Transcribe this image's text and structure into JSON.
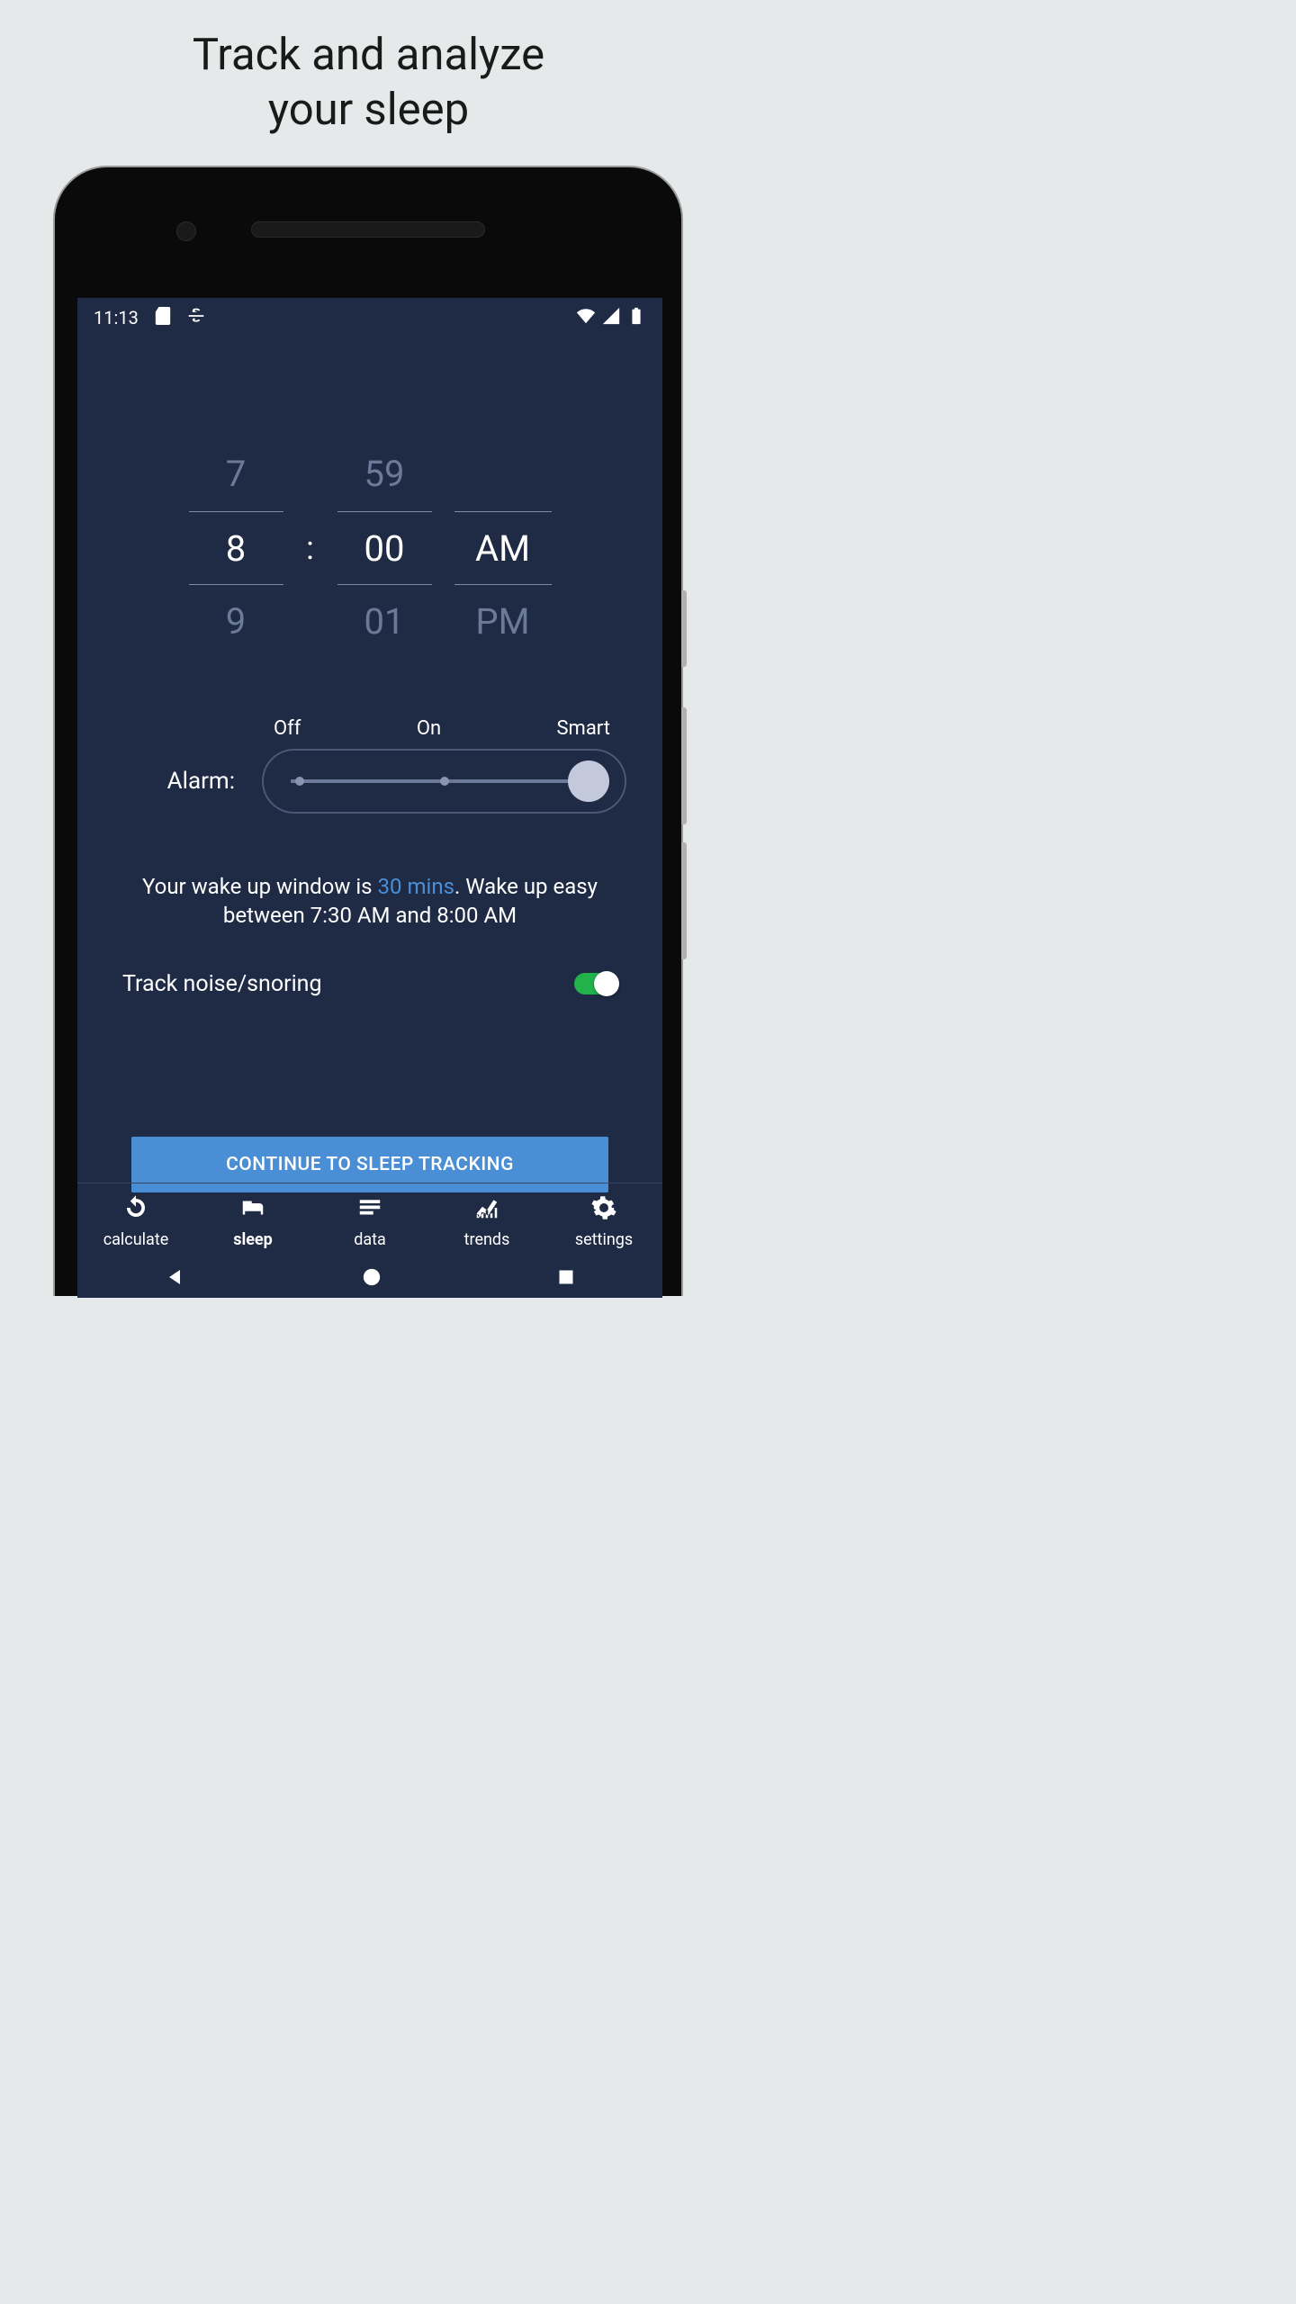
{
  "page": {
    "title_line1": "Track and analyze",
    "title_line2": "your sleep"
  },
  "status_bar": {
    "time": "11:13"
  },
  "time_picker": {
    "hour_prev": "7",
    "hour_sel": "8",
    "hour_next": "9",
    "min_prev": "59",
    "min_sel": "00",
    "min_next": "01",
    "ampm_sel": "AM",
    "ampm_next": "PM"
  },
  "alarm": {
    "label": "Alarm:",
    "options": [
      "Off",
      "On",
      "Smart"
    ],
    "selected_index": 2
  },
  "wake_window": {
    "prefix": "Your wake up window is ",
    "duration": "30 mins",
    "middle": ". Wake up easy between ",
    "start": "7:30 AM",
    "and": " and ",
    "end": "8:00 AM"
  },
  "noise_toggle": {
    "label": "Track noise/snoring",
    "on": true
  },
  "cta": "CONTINUE TO SLEEP TRACKING",
  "nav": {
    "items": [
      {
        "label": "calculate",
        "icon": "refresh-icon"
      },
      {
        "label": "sleep",
        "icon": "bed-icon"
      },
      {
        "label": "data",
        "icon": "bars-icon"
      },
      {
        "label": "trends",
        "icon": "chart-line-icon"
      },
      {
        "label": "settings",
        "icon": "gear-icon"
      }
    ],
    "active_index": 1
  }
}
